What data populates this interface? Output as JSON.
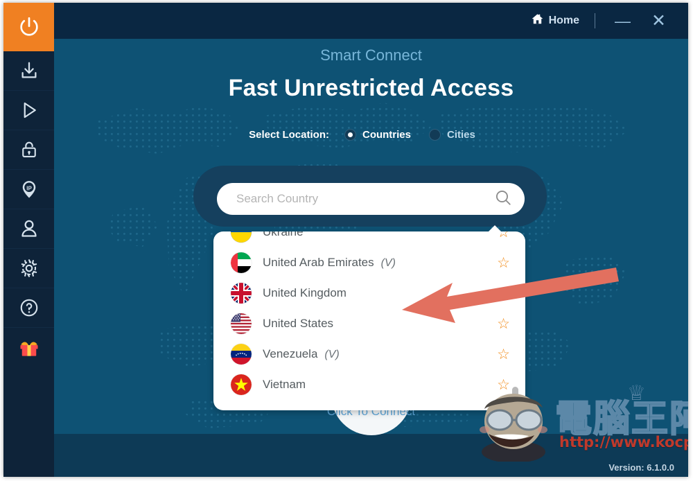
{
  "app": {
    "accent_orange": "#f08022",
    "bg_main": "#0e5274",
    "bg_titlebar": "#0a2742",
    "bg_sidebar": "#0e2339",
    "star_color": "#f29022"
  },
  "titlebar": {
    "home_label": "Home",
    "home_icon": "home-icon",
    "minimize_label": "—",
    "close_label": "✕"
  },
  "sidebar": {
    "items": [
      {
        "icon": "power-icon",
        "name": "power"
      },
      {
        "icon": "download-icon",
        "name": "download"
      },
      {
        "icon": "play-icon",
        "name": "play"
      },
      {
        "icon": "lock-icon",
        "name": "lock"
      },
      {
        "icon": "ip-location-pin-icon",
        "name": "ip-location"
      },
      {
        "icon": "user-icon",
        "name": "account"
      },
      {
        "icon": "gear-icon",
        "name": "settings"
      },
      {
        "icon": "question-circle-icon",
        "name": "help"
      },
      {
        "icon": "gift-icon",
        "name": "gift"
      }
    ]
  },
  "main": {
    "subtitle": "Smart Connect",
    "headline": "Fast Unrestricted Access",
    "select_location_label": "Select Location:",
    "location_options": [
      {
        "label": "Countries",
        "selected": true
      },
      {
        "label": "Cities",
        "selected": false
      }
    ],
    "search": {
      "placeholder": "Search Country",
      "value": "",
      "icon": "search-icon"
    },
    "connect_label": "Click To Connect",
    "version": "Version: 6.1.0.0"
  },
  "dropdown": {
    "scrollbar_visible": true,
    "items": [
      {
        "country": "Ukraine",
        "vtag": "",
        "starred": false,
        "clipped": true
      },
      {
        "country": "United Arab Emirates",
        "vtag": "(V)",
        "starred": false
      },
      {
        "country": "United Kingdom",
        "vtag": "",
        "starred": false
      },
      {
        "country": "United States",
        "vtag": "",
        "starred": false
      },
      {
        "country": "Venezuela",
        "vtag": "(V)",
        "starred": false
      },
      {
        "country": "Vietnam",
        "vtag": "",
        "starred": false
      }
    ]
  },
  "annotation": {
    "arrow_color": "#e2705f",
    "points_to": "United Kingdom"
  },
  "watermark": {
    "cjk_text": "電腦王阿達",
    "url": "http://www.kocpc.com.tw"
  }
}
